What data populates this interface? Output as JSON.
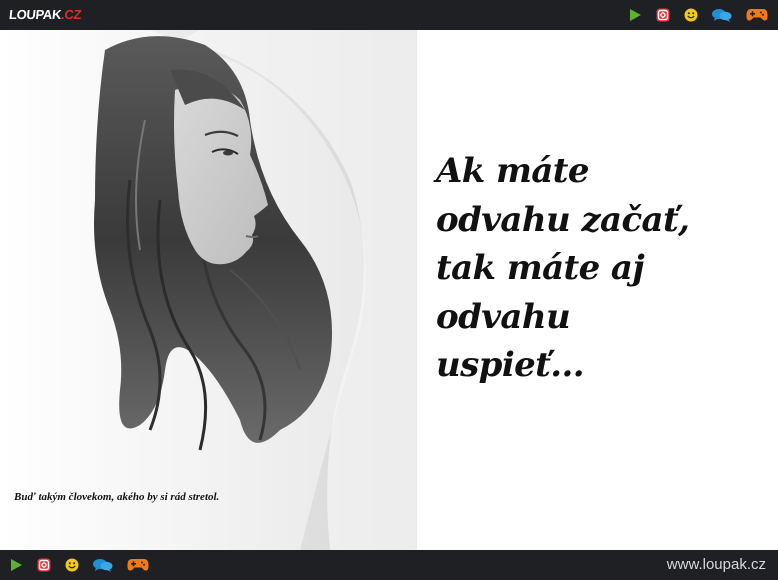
{
  "header": {
    "logo_main": "LOUPAK",
    "logo_suffix": ".CZ",
    "icons": [
      "play-icon",
      "instagram-icon",
      "smiley-icon",
      "chat-icon",
      "gamepad-icon"
    ]
  },
  "quote": {
    "lines": [
      "Ak máte",
      "odvahu začať,",
      "tak máte aj",
      "odvahu",
      "uspieť..."
    ]
  },
  "photo": {
    "caption": "Buď takým človekom, akého by si rád stretol."
  },
  "footer": {
    "icons": [
      "play-icon",
      "instagram-icon",
      "smiley-icon",
      "chat-icon",
      "gamepad-icon"
    ],
    "site_url": "www.loupak.cz"
  },
  "colors": {
    "bar_background": "#1f2023",
    "play": "#5ab22e",
    "instagram": "#e2343c",
    "smiley": "#f2c81d",
    "chat": "#1f8fd6",
    "gamepad": "#f07a18",
    "logo_accent": "#e12a2a"
  }
}
